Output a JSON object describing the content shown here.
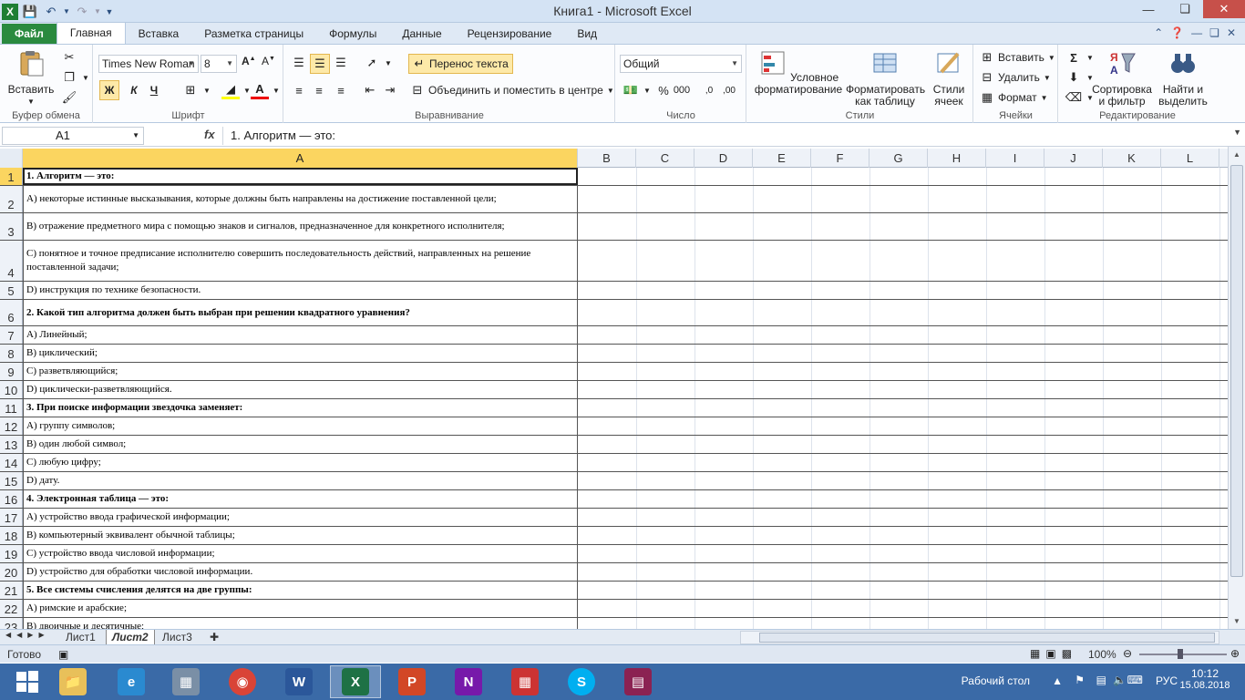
{
  "window": {
    "title": "Книга1 - Microsoft Excel"
  },
  "tabs": [
    {
      "label": "Файл"
    },
    {
      "label": "Главная"
    },
    {
      "label": "Вставка"
    },
    {
      "label": "Разметка страницы"
    },
    {
      "label": "Формулы"
    },
    {
      "label": "Данные"
    },
    {
      "label": "Рецензирование"
    },
    {
      "label": "Вид"
    }
  ],
  "ribbon": {
    "clipboard": {
      "group_label": "Буфер обмена",
      "paste_label": "Вставить"
    },
    "font": {
      "group_label": "Шрифт",
      "font_name": "Times New Roman",
      "font_size": "8",
      "bold": "Ж",
      "italic": "К",
      "underline": "Ч"
    },
    "alignment": {
      "group_label": "Выравнивание",
      "wrap_text": "Перенос текста",
      "merge_center": "Объединить и поместить в центре"
    },
    "number": {
      "group_label": "Число",
      "format": "Общий"
    },
    "styles": {
      "group_label": "Стили",
      "conditional": "Условное форматирование",
      "as_table": "Форматировать как таблицу",
      "cell_styles": "Стили ячеек"
    },
    "cells": {
      "group_label": "Ячейки",
      "insert": "Вставить",
      "delete": "Удалить",
      "format": "Формат"
    },
    "editing": {
      "group_label": "Редактирование",
      "sort_filter": "Сортировка и фильтр",
      "find_select": "Найти и выделить"
    }
  },
  "formula_bar": {
    "name_box": "A1",
    "fx": "fx",
    "content": "1. Алгоритм — это:"
  },
  "columns": [
    "A",
    "B",
    "C",
    "D",
    "E",
    "F",
    "G",
    "H",
    "I",
    "J",
    "K",
    "L"
  ],
  "rows": [
    {
      "num": "1",
      "text": "1. Алгоритм — это:",
      "bold": true
    },
    {
      "num": "2",
      "text": "А) некоторые истинные высказывания, которые должны быть направлены на достижение поставленной цели;",
      "bold": false
    },
    {
      "num": "3",
      "text": "В) отражение предметного мира с помощью знаков и сигналов, предназначенное для конкретного исполнителя;",
      "bold": false
    },
    {
      "num": "4",
      "text": "С) понятное и точное предписание исполнителю совершить последовательность действий, направленных на решение поставленной задачи;",
      "bold": false
    },
    {
      "num": "5",
      "text": "D) инструкция по технике безопасности.",
      "bold": false
    },
    {
      "num": "6",
      "text": "2. Какой тип алгоритма должен быть выбран при решении квадратного уравнения?",
      "bold": true
    },
    {
      "num": "7",
      "text": "А) Линейный;",
      "bold": false
    },
    {
      "num": "8",
      "text": "В) циклический;",
      "bold": false
    },
    {
      "num": "9",
      "text": "С) разветвляющийся;",
      "bold": false
    },
    {
      "num": "10",
      "text": "D) циклически-разветвляющийся.",
      "bold": false
    },
    {
      "num": "11",
      "text": "3. При поиске информации звездочка заменяет:",
      "bold": true
    },
    {
      "num": "12",
      "text": "А) группу символов;",
      "bold": false
    },
    {
      "num": "13",
      "text": "В) один любой символ;",
      "bold": false
    },
    {
      "num": "14",
      "text": "С) любую цифру;",
      "bold": false
    },
    {
      "num": "15",
      "text": "D) дату.",
      "bold": false
    },
    {
      "num": "16",
      "text": "4. Электронная таблица — это:",
      "bold": true
    },
    {
      "num": "17",
      "text": "А) устройство ввода графической информации;",
      "bold": false
    },
    {
      "num": "18",
      "text": "В) компьютерный эквивалент обычной таблицы;",
      "bold": false
    },
    {
      "num": "19",
      "text": "С) устройство ввода числовой информации;",
      "bold": false
    },
    {
      "num": "20",
      "text": "D) устройство для обработки числовой информации.",
      "bold": false
    },
    {
      "num": "21",
      "text": "5. Все системы счисления делятся на две группы:",
      "bold": true
    },
    {
      "num": "22",
      "text": "А) римские и арабские;",
      "bold": false
    },
    {
      "num": "23",
      "text": "В) двоичные и десятичные;",
      "bold": false
    }
  ],
  "sheets": [
    {
      "label": "Лист1"
    },
    {
      "label": "Лист2"
    },
    {
      "label": "Лист3"
    }
  ],
  "status": {
    "ready": "Готово",
    "zoom": "100%"
  },
  "taskbar": {
    "desktop_label": "Рабочий стол",
    "lang": "РУС",
    "time": "10:12",
    "date": "15.08.2018"
  },
  "colors": {
    "accent": "#2a8a3f",
    "header_active": "#fbd560",
    "taskbar": "#3a6aa7"
  }
}
